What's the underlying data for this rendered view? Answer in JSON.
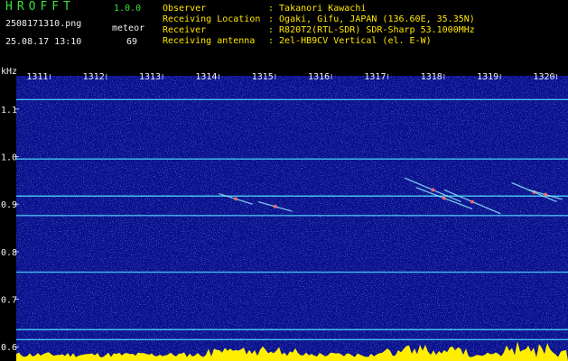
{
  "header": {
    "brand": "HROFFT",
    "version": "1.0.0",
    "filename": "2508171310.png",
    "datetime": "25.08.17 13:10",
    "meteor_label": "meteor",
    "meteor_count": "69",
    "info": [
      {
        "label": "Observer",
        "value": ": Takanori Kawachi"
      },
      {
        "label": "Receiving Location",
        "value": ": Ogaki, Gifu, JAPAN (136.60E, 35.35N)"
      },
      {
        "label": "Receiver",
        "value": ": R820T2(RTL-SDR) SDR-Sharp 53.1000MHz"
      },
      {
        "label": "Receiving antenna",
        "value": ": 2el-HB9CV Vertical (el. E-W)"
      }
    ]
  },
  "colors": {
    "background": "#0a0f8c",
    "text_green": "#39e039",
    "text_white": "#f0f0f0",
    "text_yellow": "#ffe600",
    "spectrum_yellow": "#ffee00",
    "band_cyan": "#4fd8ff"
  },
  "chart_data": {
    "type": "heatmap",
    "title": "",
    "ylabel": "kHz",
    "xlabel": "",
    "x_ticks": [
      "1311",
      "1312",
      "1313",
      "1314",
      "1315",
      "1316",
      "1317",
      "1318",
      "1319",
      "1320"
    ],
    "x_tick_values": [
      1311,
      1312,
      1313,
      1314,
      1315,
      1316,
      1317,
      1318,
      1319,
      1320
    ],
    "xlim": [
      1310.4,
      1320.2
    ],
    "y_ticks": [
      "1.1",
      "1.0",
      "0.9",
      "0.8",
      "0.7",
      "0.6"
    ],
    "y_tick_values": [
      1.1,
      1.0,
      0.9,
      0.8,
      0.7,
      0.6
    ],
    "ylim": [
      0.57,
      1.17
    ],
    "carrier_lines_khz": [
      1.12,
      0.995,
      0.917,
      0.876,
      0.757,
      0.636,
      0.615
    ],
    "meteor_echoes": [
      {
        "x_start": 1314.0,
        "y_start": 0.922,
        "x_end": 1314.6,
        "y_end": 0.9
      },
      {
        "x_start": 1314.7,
        "y_start": 0.905,
        "x_end": 1315.3,
        "y_end": 0.885
      },
      {
        "x_start": 1317.3,
        "y_start": 0.955,
        "x_end": 1318.3,
        "y_end": 0.905
      },
      {
        "x_start": 1317.5,
        "y_start": 0.935,
        "x_end": 1318.5,
        "y_end": 0.89
      },
      {
        "x_start": 1318.0,
        "y_start": 0.93,
        "x_end": 1319.0,
        "y_end": 0.88
      },
      {
        "x_start": 1319.2,
        "y_start": 0.945,
        "x_end": 1320.0,
        "y_end": 0.905
      },
      {
        "x_start": 1319.5,
        "y_start": 0.93,
        "x_end": 1320.1,
        "y_end": 0.91
      }
    ]
  }
}
